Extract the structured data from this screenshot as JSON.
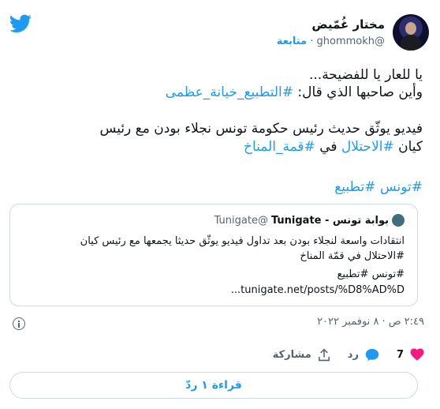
{
  "author": {
    "display_name": "مختار غُمّيض",
    "handle": "@ghommokh",
    "separator": "·",
    "follow_label": "متابعة"
  },
  "tweet": {
    "line1": "يا للعار يا للفضيحة...",
    "line2_text": "وأين صاحبها الذي قال: ",
    "line2_tag": "#التطبيع_خيانة_عظمى",
    "line3": "فيديو يوثّق حديث رئيس حكومة تونس نجلاء بودن مع رئيس",
    "line4_text1": "كيان ",
    "line4_tag1": "#الاحتلال",
    "line4_text2": " في ",
    "line4_tag2": "#قمة_المناخ",
    "line5_tag1": "#تونس",
    "line5_tag2": "#تطبيع"
  },
  "quote": {
    "name": "بوابة تونس - Tunigate",
    "handle": "@Tunigate",
    "line1": "انتقادات واسعة لنجلاء بودن بعد تداول فيديو يوثّق حديثا يجمعها مع رئيس كيان",
    "line2": "#الاحتلال في قمّة المناخ",
    "line3": "#تونس #تطبيع",
    "link": "tunigate.net/posts/%D8%AD%D..."
  },
  "meta": {
    "timestamp": "٢:٤٩ ص · ٨ نوفمبر ٢٠٢٢"
  },
  "actions": {
    "like_count": "7",
    "reply_label": "رد",
    "share_label": "مشاركة"
  },
  "reply_button": {
    "label": "قراءة ١ ردّ"
  },
  "colors": {
    "accent": "#1d9bf0",
    "like": "#f91880",
    "muted": "#536471",
    "border": "#cfd9de"
  }
}
